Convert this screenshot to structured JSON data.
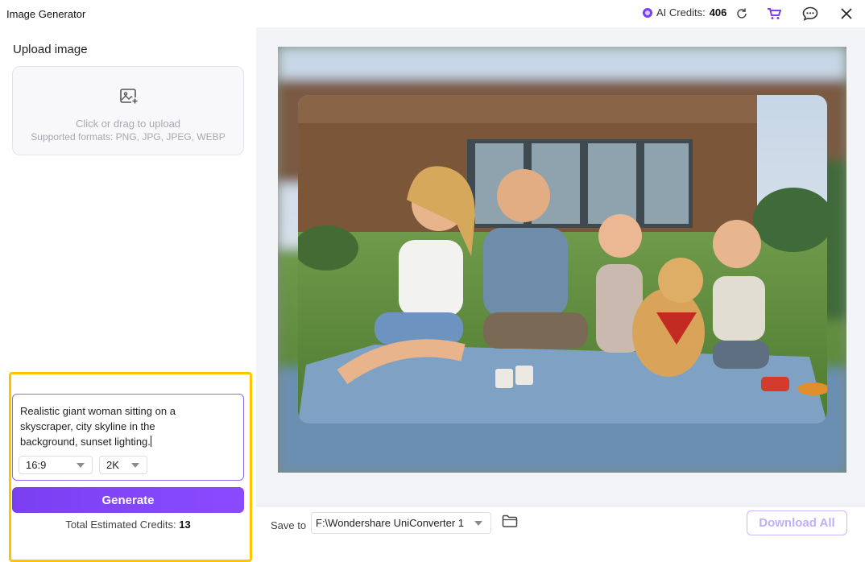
{
  "app": {
    "title": "Image Generator"
  },
  "header": {
    "credits_label": "AI Credits:",
    "credits_value": "406",
    "icons": [
      "gem-icon",
      "refresh-icon",
      "cart-icon",
      "feedback-icon",
      "close-icon"
    ]
  },
  "upload": {
    "label": "Upload image",
    "hint": "Click or drag to upload",
    "formats": "Supported formats: PNG, JPG, JPEG, WEBP"
  },
  "prompt": {
    "text": "Realistic giant woman sitting on a skyscraper, city skyline in the background, sunset lighting.",
    "aspect_ratio": "16:9",
    "resolution": "2K"
  },
  "generate": {
    "button_label": "Generate",
    "estimate_label": "Total Estimated Credits:",
    "estimate_value": "13"
  },
  "footer": {
    "save_to_label": "Save to",
    "save_path": "F:\\Wondershare UniConverter 1",
    "download_all_label": "Download All"
  },
  "colors": {
    "accent": "#7b3ff2",
    "highlight": "#ffc400",
    "download_disabled": "#c2aef8"
  }
}
